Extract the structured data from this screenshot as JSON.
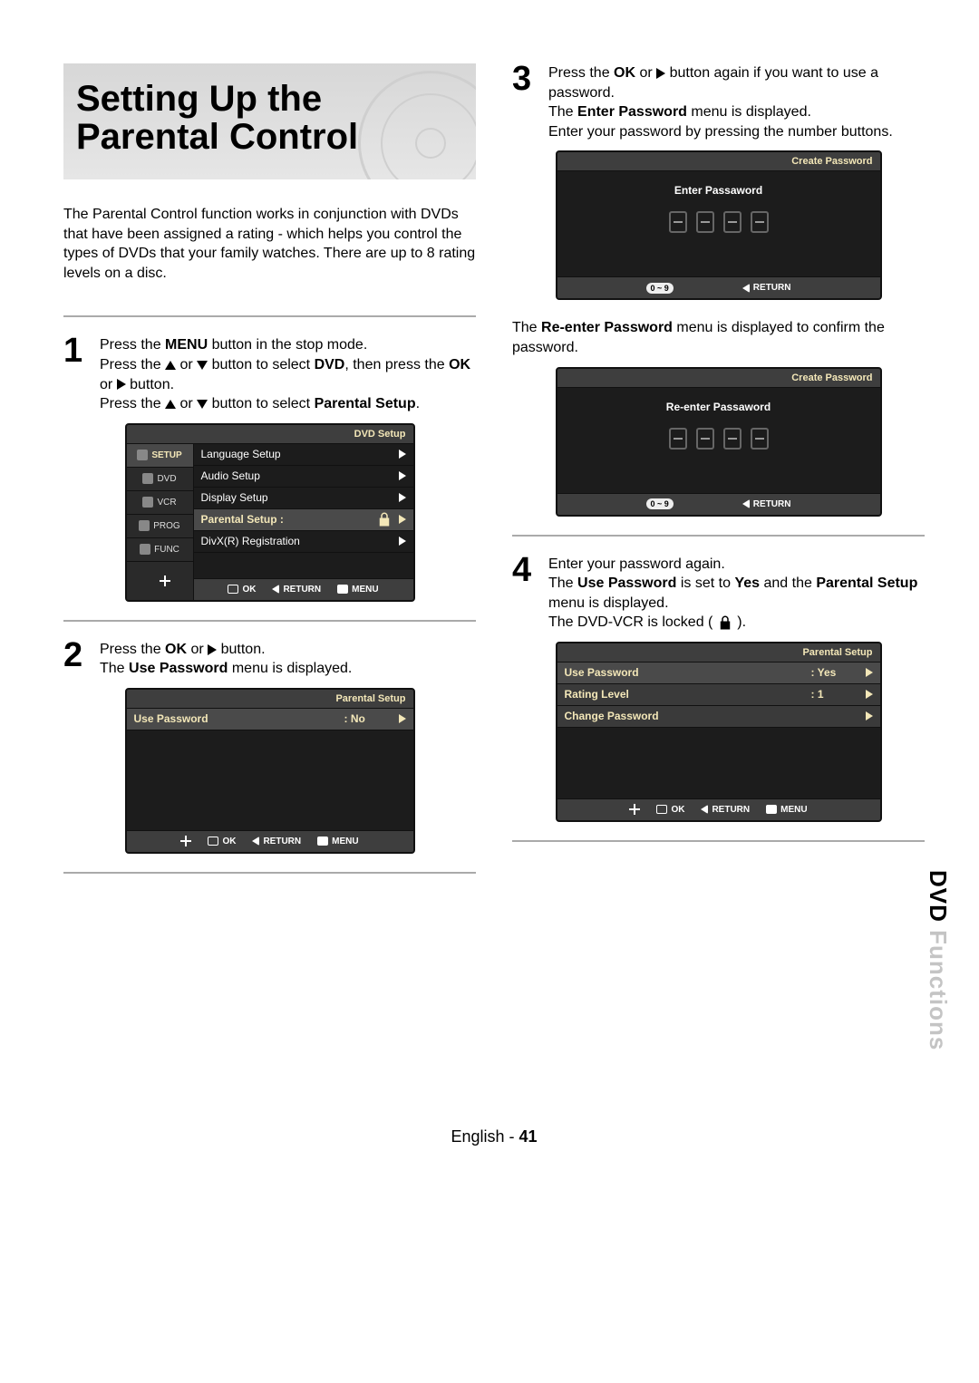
{
  "banner": {
    "title": "Setting Up the Parental Control"
  },
  "intro": "The Parental Control function works in conjunction with DVDs that have been assigned a rating - which helps you control the types of DVDs that your family watches. There are up to 8 rating levels on a disc.",
  "steps": {
    "s1": {
      "num": "1",
      "l1a": "Press the ",
      "l1b": "MENU",
      "l1c": " button in the stop mode.",
      "l2a": "Press the ",
      "l2b": " or ",
      "l2c": " button to select ",
      "l2d": "DVD",
      "l2e": ", then press the ",
      "l2f": "OK",
      "l2g": " or ",
      "l2h": " button.",
      "l3a": "Press the ",
      "l3b": " or ",
      "l3c": " button to select ",
      "l3d": "Parental Setup",
      "l3e": "."
    },
    "s2": {
      "num": "2",
      "l1a": "Press the ",
      "l1b": "OK",
      "l1c": " or ",
      "l1d": " button.",
      "l2a": "The ",
      "l2b": "Use Password",
      "l2c": " menu is displayed."
    },
    "s3": {
      "num": "3",
      "l1a": "Press  the ",
      "l1b": "OK",
      "l1c": " or ",
      "l1d": " button again if you want to use a password.",
      "l2a": "The ",
      "l2b": "Enter Password",
      "l2c": " menu is displayed.",
      "l3": "Enter your password by pressing the number buttons."
    },
    "s4": {
      "num": "4",
      "l1": "Enter your password again.",
      "l2a": "The ",
      "l2b": "Use Password",
      "l2c": " is set to ",
      "l2d": "Yes",
      "l2e": " and the ",
      "l2f": "Parental Setup",
      "l2g": " menu is displayed.",
      "l3": "The DVD-VCR is locked ( "
    },
    "reenter": {
      "a": "The ",
      "b": "Re-enter Password",
      "c": " menu is displayed to confirm the password."
    }
  },
  "osd": {
    "dvdSetup": {
      "title": "DVD  Setup",
      "tabs": [
        "SETUP",
        "DVD",
        "VCR",
        "PROG",
        "FUNC"
      ],
      "items": [
        "Language Setup",
        "Audio Setup",
        "Display Setup",
        "Parental Setup  :",
        "DivX(R) Registration"
      ],
      "footer": [
        "OK",
        "RETURN",
        "MENU"
      ]
    },
    "parentalNo": {
      "title": "Parental Setup",
      "row1_label": "Use Password",
      "row1_val": ": No",
      "footer": [
        "OK",
        "RETURN",
        "MENU"
      ]
    },
    "createPw": {
      "title": "Create Password",
      "prompt1": "Enter Passaword",
      "prompt2": "Re-enter Passaword",
      "footer_badge": "0 ~ 9",
      "footer_return": "RETURN"
    },
    "parentalYes": {
      "title": "Parental Setup",
      "rows": [
        {
          "label": "Use Password",
          "val": ": Yes"
        },
        {
          "label": "Rating Level",
          "val": ": 1"
        },
        {
          "label": "Change Password",
          "val": ""
        }
      ],
      "footer": [
        "OK",
        "RETURN",
        "MENU"
      ]
    }
  },
  "sideTab": {
    "bold": "DVD ",
    "dim": "Functions"
  },
  "footer": {
    "lang": "English - ",
    "page": "41"
  }
}
